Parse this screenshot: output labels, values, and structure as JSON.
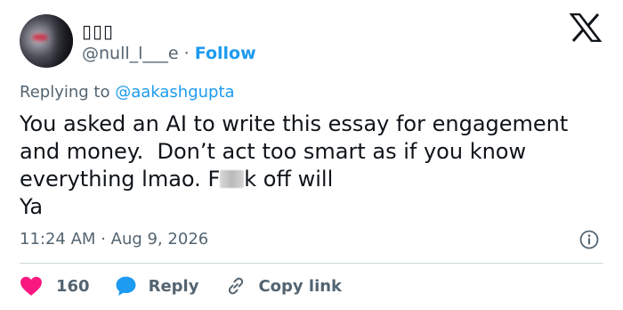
{
  "author": {
    "display_name": "▯▯▯",
    "handle": "@null_l___e",
    "separator": "·",
    "follow_label": "Follow"
  },
  "reply_context": {
    "prefix": "Replying to",
    "mention": "@aakashgupta"
  },
  "tweet": {
    "line1": "You asked an AI to write this essay for engagement",
    "line2": "and money.  Don’t act too smart as if you know",
    "line3_before": "everything lmao. F",
    "line3_after": "k off will",
    "line4": "Ya"
  },
  "meta": {
    "time": "11:24 AM",
    "separator": "·",
    "date": "Aug 9, 2026"
  },
  "actions": {
    "like_count": "160",
    "reply_label": "Reply",
    "copy_label": "Copy link"
  },
  "colors": {
    "accent": "#1d9bf0",
    "like": "#f91880",
    "text": "#0f1419",
    "muted": "#536471"
  },
  "icons": {
    "logo": "x-logo-icon",
    "info": "info-icon",
    "like": "heart-icon",
    "reply": "speech-bubble-icon",
    "copy": "link-icon"
  }
}
